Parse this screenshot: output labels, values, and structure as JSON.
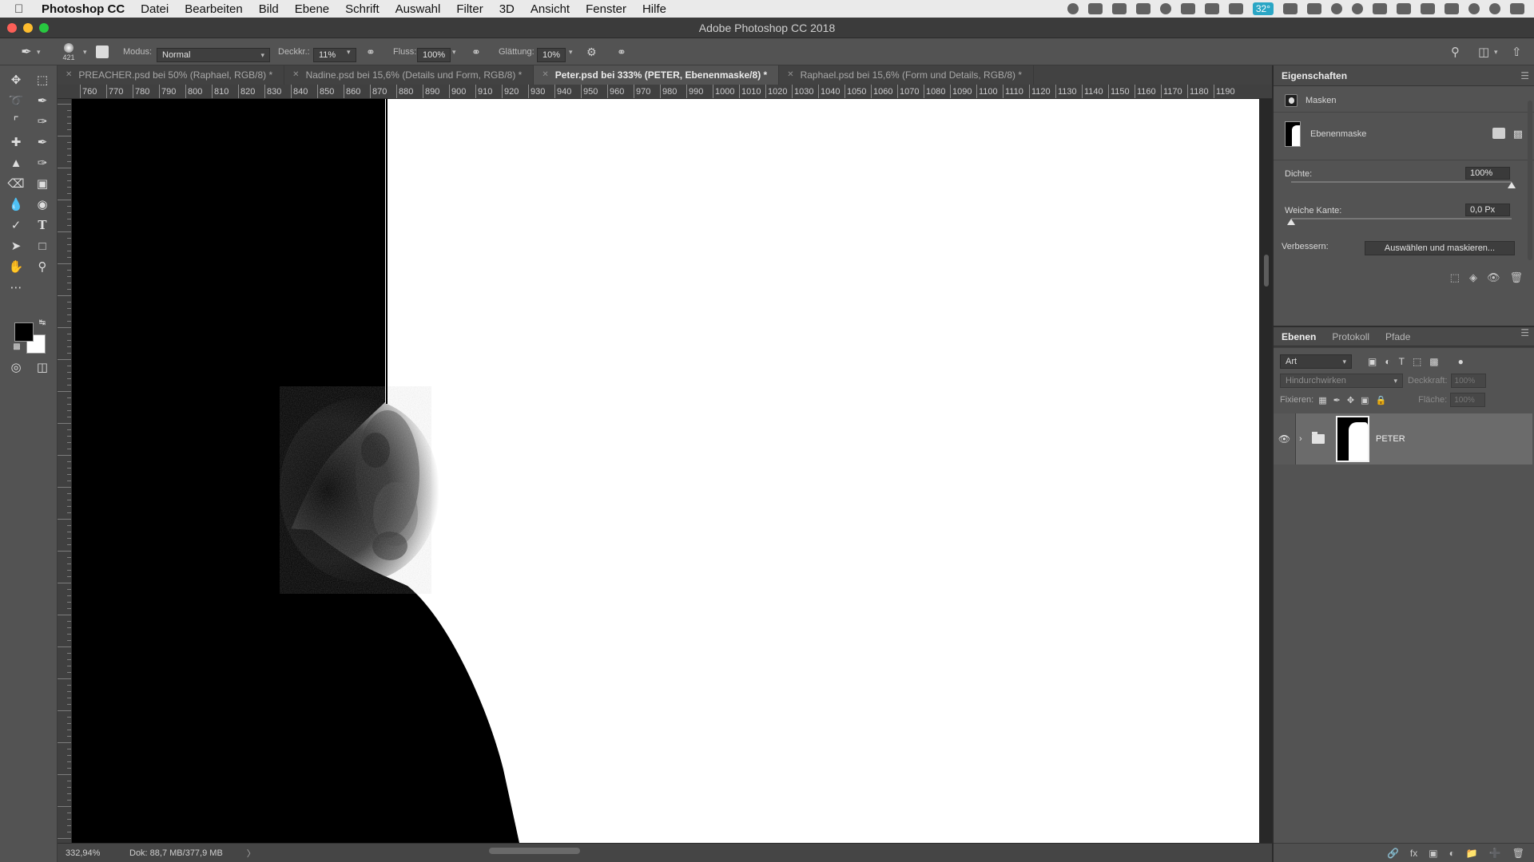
{
  "menubar": {
    "apple": "",
    "items": [
      "Photoshop CC",
      "Datei",
      "Bearbeiten",
      "Bild",
      "Ebene",
      "Schrift",
      "Auswahl",
      "Filter",
      "3D",
      "Ansicht",
      "Fenster",
      "Hilfe"
    ],
    "temp": "32°"
  },
  "window": {
    "title": "Adobe Photoshop CC 2018"
  },
  "options": {
    "brush_size": "421",
    "modus_label": "Modus:",
    "modus_value": "Normal",
    "deckkraft_label": "Deckkr.:",
    "deckkraft_value": "11%",
    "fluss_label": "Fluss:",
    "fluss_value": "100%",
    "glaettung_label": "Glättung:",
    "glaettung_value": "10%"
  },
  "tabs": [
    {
      "label": "PREACHER.psd bei 50% (Raphael, RGB/8) *",
      "active": false
    },
    {
      "label": "Nadine.psd bei 15,6% (Details und Form, RGB/8) *",
      "active": false
    },
    {
      "label": "Peter.psd bei 333% (PETER, Ebenenmaske/8) *",
      "active": true
    },
    {
      "label": "Raphael.psd bei 15,6% (Form und Details, RGB/8) *",
      "active": false
    }
  ],
  "ruler": {
    "h_ticks": [
      "760",
      "770",
      "780",
      "790",
      "800",
      "810",
      "820",
      "830",
      "840",
      "850",
      "860",
      "870",
      "880",
      "890",
      "900",
      "910",
      "920",
      "930",
      "940",
      "950",
      "960",
      "970",
      "980",
      "990",
      "1000",
      "1010",
      "1020",
      "1030",
      "1040",
      "1050",
      "1060",
      "1070",
      "1080",
      "1090",
      "1100",
      "1110",
      "1120",
      "1130",
      "1140",
      "1150",
      "1160",
      "1170",
      "1180",
      "1190"
    ]
  },
  "statusbar": {
    "zoom": "332,94%",
    "doc": "Dok: 88,7 MB/377,9 MB",
    "more": "〉"
  },
  "properties": {
    "title": "Eigenschaften",
    "section": "Masken",
    "mask_type": "Ebenenmaske",
    "dichte_label": "Dichte:",
    "dichte_value": "100%",
    "dichte_level": 1.0,
    "kante_label": "Weiche Kante:",
    "kante_value": "0,0 Px",
    "kante_level": 0.0,
    "verbessern_label": "Verbessern:",
    "auswaehlen_button": "Auswählen und maskieren..."
  },
  "layers": {
    "tabs": [
      "Ebenen",
      "Protokoll",
      "Pfade"
    ],
    "filter": "Art",
    "blend": "Hindurchwirken",
    "deckkraft_label": "Deckkraft:",
    "deckkraft_value": "100%",
    "fixieren_label": "Fixieren:",
    "flaeche_label": "Fläche:",
    "flaeche_value": "100%",
    "layer_name": "PETER"
  }
}
